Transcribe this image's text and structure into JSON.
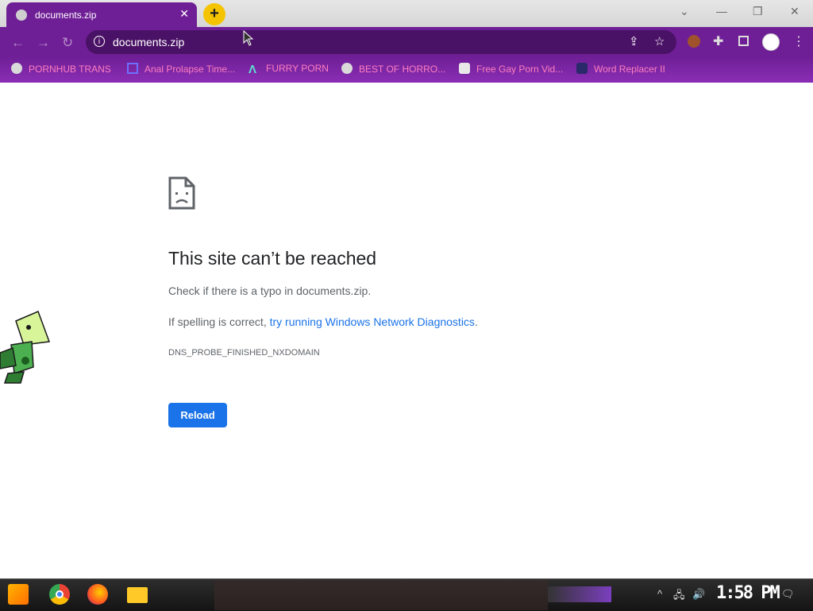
{
  "browser": {
    "tab": {
      "title": "documents.zip",
      "close_glyph": "✕"
    },
    "new_tab_glyph": "+",
    "window_controls": {
      "tabsearch": "⌄",
      "minimize": "—",
      "restore": "❐",
      "close": "✕"
    },
    "nav": {
      "back": "←",
      "forward": "→",
      "reload": "↻"
    },
    "omnibox": {
      "info_glyph": "i",
      "url": "documents.zip"
    },
    "toolbar_icons": [
      "share-icon",
      "star-icon",
      "extension-avatar-icon",
      "puzzle-icon",
      "sidepanel-icon",
      "profile-icon",
      "menu-icon"
    ],
    "accent_color": "#6f1f96"
  },
  "bookmarks": [
    {
      "label": "PORNHUB TRANS",
      "icon": "globe-icon"
    },
    {
      "label": "Anal Prolapse Time...",
      "icon": "pink-arrow-icon"
    },
    {
      "label": "FURRY PORN",
      "icon": "lambda-icon"
    },
    {
      "label": "BEST OF HORRO...",
      "icon": "globe-icon"
    },
    {
      "label": "Free Gay Porn Vid...",
      "icon": "skull-icon"
    },
    {
      "label": "Word Replacer II",
      "icon": "wr-icon"
    }
  ],
  "error": {
    "heading": "This site can’t be reached",
    "typo_line": "Check if there is a typo in documents.zip.",
    "spelling_prefix": "If spelling is correct,",
    "spelling_link": "try running Windows Network Diagnostics",
    "spelling_suffix": ".",
    "code": "DNS_PROBE_FINISHED_NXDOMAIN",
    "reload_label": "Reload"
  },
  "taskbar": {
    "apps": [
      "start-icon",
      "chrome-icon",
      "firefox-icon",
      "folder-icon"
    ],
    "tray": {
      "chevron": "^",
      "network": "🖧",
      "volume": "🔊",
      "notification": "🗨"
    },
    "clock": "1:58 PM"
  }
}
